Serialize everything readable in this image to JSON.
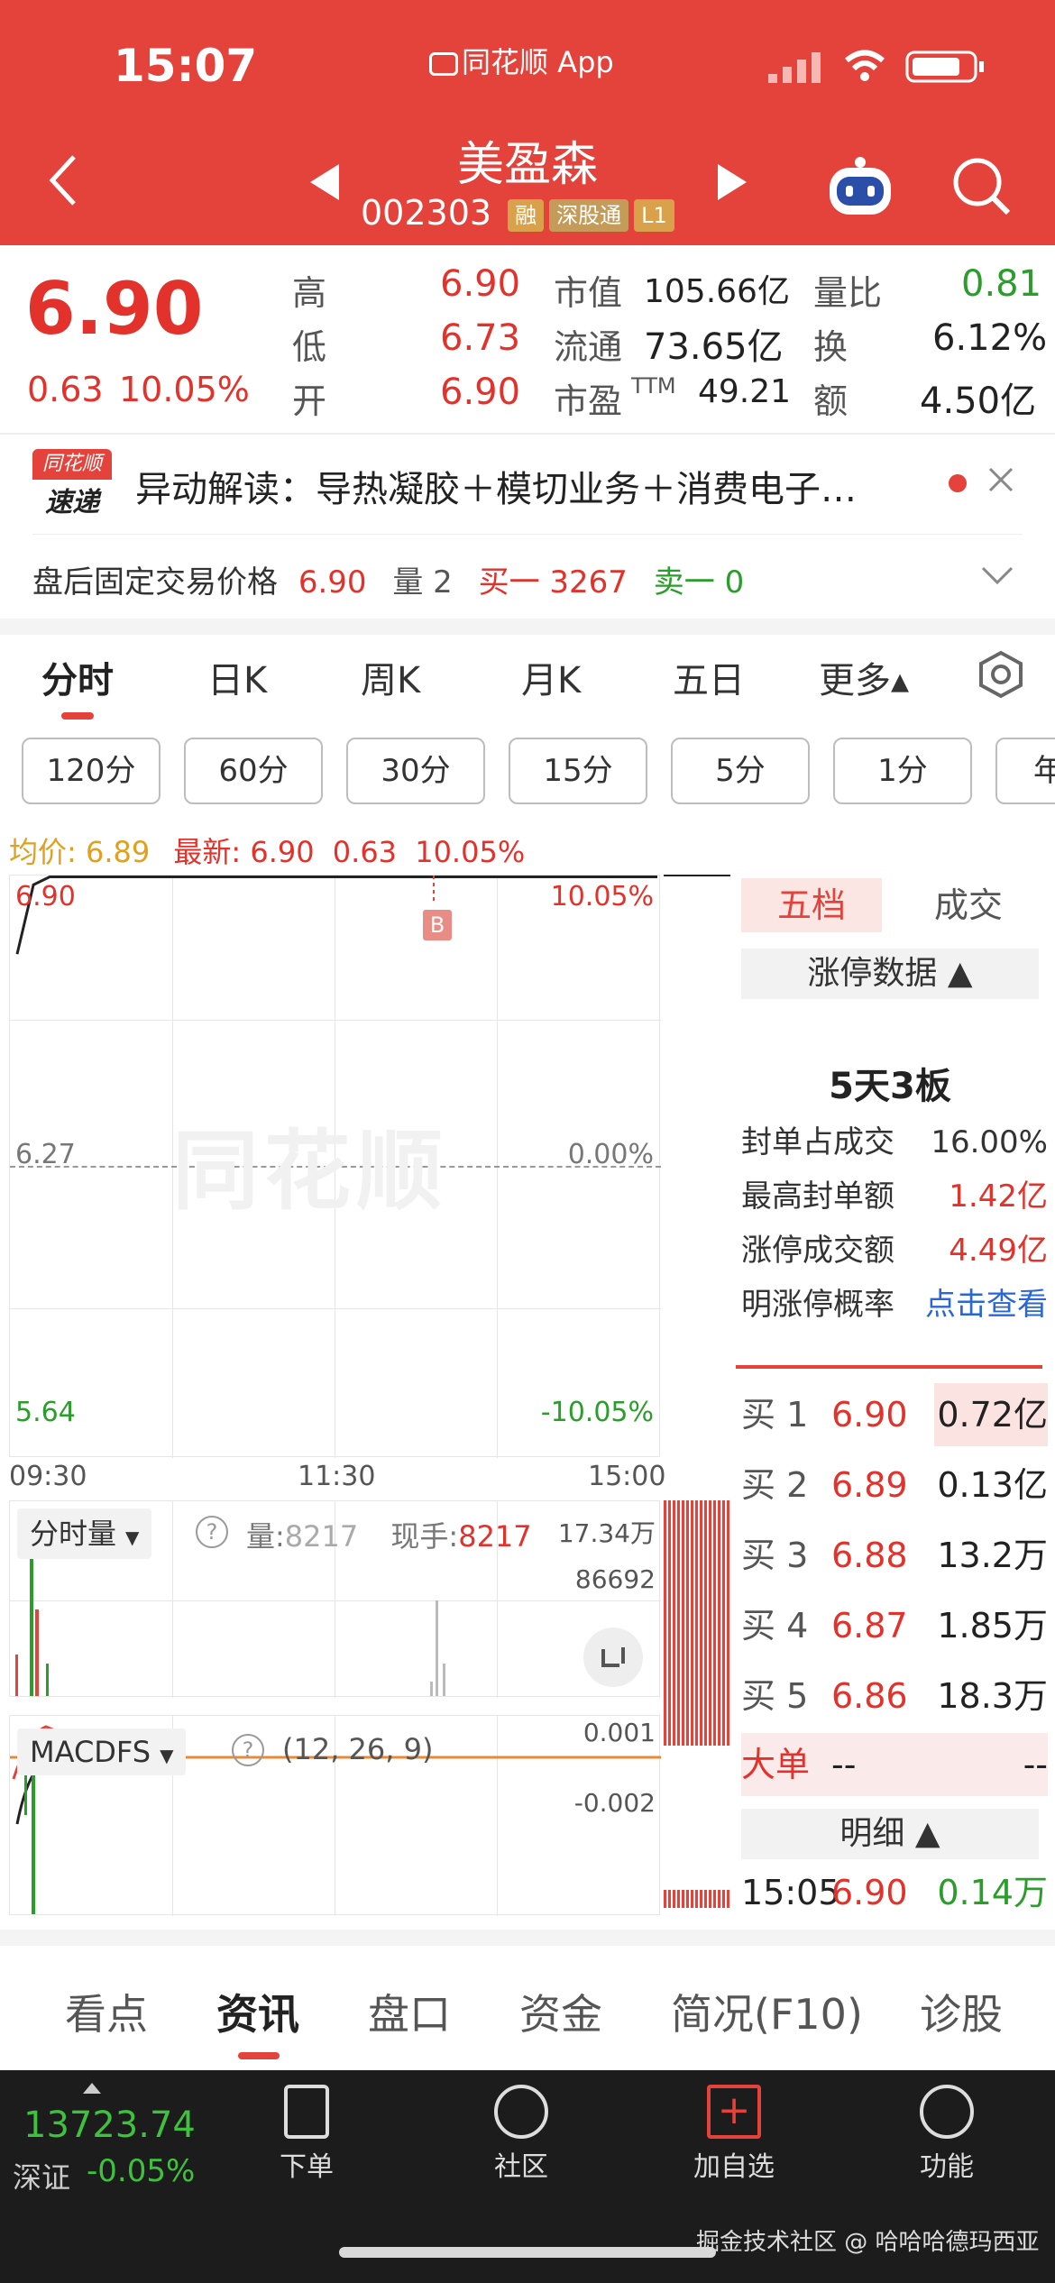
{
  "status_bar": {
    "time": "15:07",
    "app_name": "同花顺 App"
  },
  "header": {
    "stock_name": "美盈森",
    "stock_code": "002303",
    "tags": [
      "融",
      "深股通",
      "L1"
    ],
    "icons": [
      "back-icon",
      "prev-stock-icon",
      "next-stock-icon",
      "robot-icon",
      "search-icon"
    ]
  },
  "quote": {
    "price": "6.90",
    "change": "0.63",
    "change_pct": "10.05%",
    "high_label": "高",
    "high": "6.90",
    "low_label": "低",
    "low": "6.73",
    "open_label": "开",
    "open": "6.90",
    "mktcap_label": "市值",
    "mktcap": "105.66亿",
    "float_label": "流通",
    "float": "73.65亿",
    "pe_label": "市盈",
    "pe_ttm": "TTM",
    "pe": "49.21",
    "volratio_label": "量比",
    "volratio": "0.81",
    "turnover_label": "换",
    "turnover": "6.12%",
    "amount_label": "额",
    "amount": "4.50亿"
  },
  "news": {
    "logo_line1": "同花顺",
    "logo_line2": "速递",
    "text": "异动解读：导热凝胶＋模切业务＋消费电子…"
  },
  "after_hours": {
    "label": "盘后固定交易价格",
    "price": "6.90",
    "vol_label": "量",
    "vol": "2",
    "buy1_label": "买一",
    "buy1": "3267",
    "sell1_label": "卖一",
    "sell1": "0"
  },
  "period_tabs": [
    "分时",
    "日K",
    "周K",
    "月K",
    "五日",
    "更多▴"
  ],
  "minute_chips": [
    "120分",
    "60分",
    "30分",
    "15分",
    "5分",
    "1分",
    "年"
  ],
  "chart_info": {
    "avg_label": "均价:",
    "avg": "6.89",
    "latest_label": "最新:",
    "latest": "6.90",
    "change": "0.63",
    "change_pct": "10.05%"
  },
  "chart_data": {
    "type": "line",
    "title": "",
    "y_left_ticks": [
      "6.90",
      "6.27",
      "5.64"
    ],
    "y_right_ticks": [
      "10.05%",
      "0.00%",
      "-10.05%"
    ],
    "x_ticks": [
      "09:30",
      "11:30",
      "15:00"
    ],
    "ylim": [
      5.64,
      6.9
    ],
    "series": [
      {
        "values": [
          6.73,
          6.88,
          6.9,
          6.9,
          6.9,
          6.9,
          6.9,
          6.9
        ]
      }
    ],
    "marker": "B",
    "watermark": "同花顺"
  },
  "volume_panel": {
    "selector": "分时量",
    "vol_label": "量:",
    "vol": "8217",
    "hand_label": "现手:",
    "hand": "8217",
    "max_tick": "17.34万",
    "mid_tick": "86692"
  },
  "macd_panel": {
    "selector": "MACDFS",
    "params": "(12, 26, 9)",
    "top_tick": "0.001",
    "bottom_tick": "-0.002"
  },
  "order_book": {
    "tab_five": "五档",
    "tab_trade": "成交",
    "limit_header": "涨停数据 ▲",
    "limit_title": "5天3板",
    "rows": [
      {
        "label": "封单占成交",
        "value": "16.00%"
      },
      {
        "label": "最高封单额",
        "value": "1.42亿"
      },
      {
        "label": "涨停成交额",
        "value": "4.49亿"
      },
      {
        "label": "明涨停概率",
        "value": "点击查看"
      }
    ],
    "bids": [
      {
        "label": "买 1",
        "price": "6.90",
        "vol": "0.72亿"
      },
      {
        "label": "买 2",
        "price": "6.89",
        "vol": "0.13亿"
      },
      {
        "label": "买 3",
        "price": "6.88",
        "vol": "13.2万"
      },
      {
        "label": "买 4",
        "price": "6.87",
        "vol": "1.85万"
      },
      {
        "label": "买 5",
        "price": "6.86",
        "vol": "18.3万"
      }
    ],
    "big_order_label": "大单",
    "big_order_a": "--",
    "big_order_b": "--",
    "detail_header": "明细 ▲",
    "last_trade": {
      "time": "15:05",
      "price": "6.90",
      "vol": "0.14万"
    }
  },
  "bottom_tabs": [
    "看点",
    "资讯",
    "盘口",
    "资金",
    "简况(F10)",
    "诊股"
  ],
  "nav": {
    "index_value": "13723.74",
    "index_name": "深证",
    "index_change": "-0.05%",
    "items": [
      "下单",
      "社区",
      "加自选",
      "功能"
    ]
  },
  "watermark_footer": "掘金技术社区 @ 哈哈哈德玛西亚"
}
